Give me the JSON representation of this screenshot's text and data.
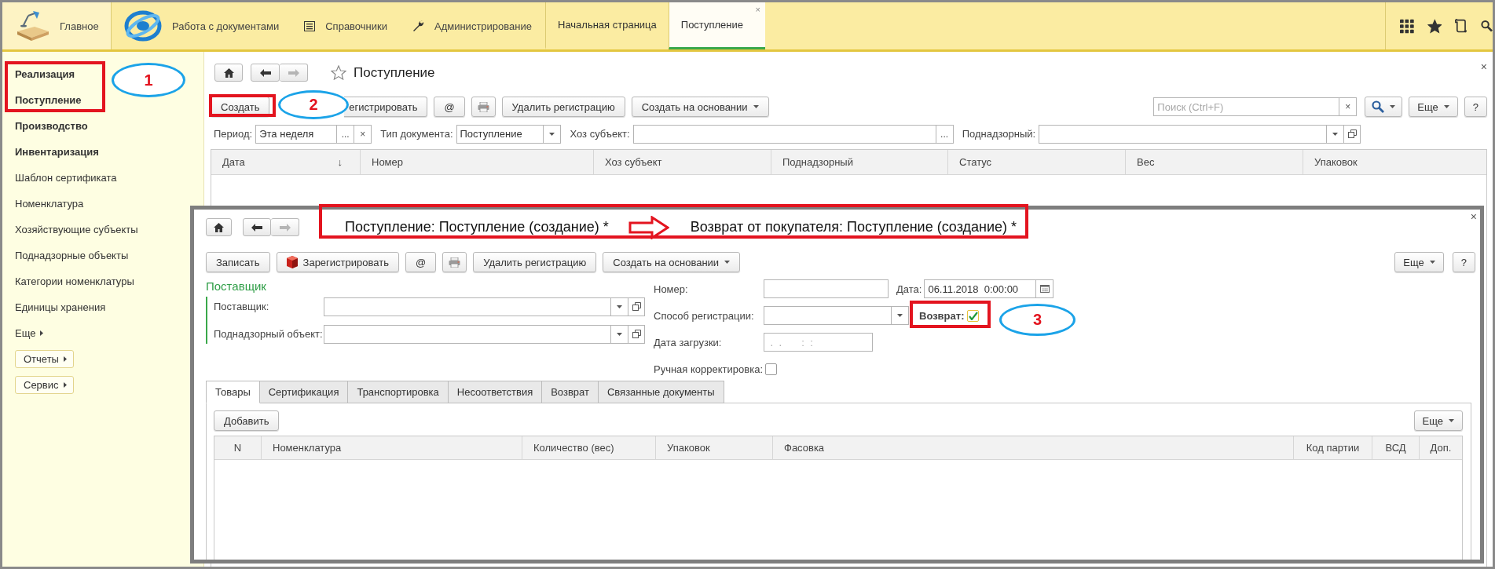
{
  "top_bar": {
    "home": {
      "label": "Главное"
    },
    "sections": [
      {
        "label": "Работа с документами",
        "kind": "logo"
      },
      {
        "label": "Справочники",
        "kind": "list"
      },
      {
        "label": "Администрирование",
        "kind": "wrench"
      }
    ],
    "open_tabs": [
      {
        "label": "Начальная страница",
        "selected": false
      },
      {
        "label": "Поступление",
        "selected": true,
        "close": "×"
      }
    ]
  },
  "sidebar": {
    "items": [
      {
        "label": "Реализация",
        "bold": true
      },
      {
        "label": "Поступление",
        "bold": true
      },
      {
        "label": "Производство",
        "bold": true
      },
      {
        "label": "Инвентаризация",
        "bold": true
      },
      {
        "label": "Шаблон сертификата",
        "bold": false
      },
      {
        "label": "Номенклатура",
        "bold": false
      },
      {
        "label": "Хозяйствующие субъекты",
        "bold": false
      },
      {
        "label": "Поднадзорные объекты",
        "bold": false
      },
      {
        "label": "Категории номенклатуры",
        "bold": false
      },
      {
        "label": "Единицы хранения",
        "bold": false
      }
    ],
    "more": "Еще",
    "buttons": [
      {
        "label": "Отчеты"
      },
      {
        "label": "Сервис"
      }
    ]
  },
  "list_form": {
    "title": "Поступление",
    "close": "×",
    "toolbar": [
      {
        "label": "Создать",
        "kind": "button"
      },
      {
        "label": "егистрировать",
        "kind": "covered"
      },
      {
        "label": "@",
        "kind": "button"
      },
      {
        "kind": "print"
      },
      {
        "label": "Удалить регистрацию",
        "kind": "button"
      },
      {
        "label": "Создать на основании",
        "kind": "menu"
      }
    ],
    "search": {
      "placeholder": "Поиск (Ctrl+F)",
      "clear": "×"
    },
    "more": "Еще",
    "help": "?",
    "filters": [
      {
        "label": "Период:",
        "value": "Эта неделя",
        "buttons": [
          "...",
          "×"
        ],
        "dropdown": false,
        "open_button": false
      },
      {
        "label": "Тип документа:",
        "value": "Поступление",
        "dropdown": true,
        "open_button": false
      },
      {
        "label": "Хоз субъект:",
        "buttons": [
          "..."
        ],
        "dropdown": false,
        "open_button": false
      },
      {
        "label": "Поднадзорный:",
        "dropdown": true,
        "open_button": true
      }
    ],
    "columns": [
      {
        "label": "Дата",
        "sort": "↓"
      },
      {
        "label": "Номер"
      },
      {
        "label": "Хоз субъект"
      },
      {
        "label": "Поднадзорный"
      },
      {
        "label": "Статус"
      },
      {
        "label": "Вес"
      },
      {
        "label": "Упаковок"
      }
    ]
  },
  "document_form": {
    "title": "Поступление: Поступление (создание) *",
    "new_title": "Возврат от покупателя: Поступление (создание) *",
    "close": "×",
    "toolbar": [
      {
        "label": "Записать",
        "kind": "button"
      },
      {
        "label": "Зарегистрировать",
        "kind": "register"
      },
      {
        "label": "@",
        "kind": "button"
      },
      {
        "kind": "print"
      },
      {
        "label": "Удалить регистрацию",
        "kind": "button"
      },
      {
        "label": "Создать на основании",
        "kind": "menu"
      }
    ],
    "more": "Еще",
    "help": "?",
    "group": {
      "title": "Поставщик",
      "fields": [
        {
          "label": "Поставщик:"
        },
        {
          "label": "Поднадзорный объект:"
        }
      ]
    },
    "number": {
      "label": "Номер:"
    },
    "date": {
      "label": "Дата:",
      "value": "06.11.2018  0:00:00"
    },
    "registration": {
      "label": "Способ регистрации:"
    },
    "return": {
      "label": "Возврат:",
      "checked": true
    },
    "load_date": {
      "label": "Дата загрузки:",
      "placeholder": " .  .       :  :"
    },
    "manual": {
      "label": "Ручная корректировка:",
      "checked": false
    },
    "tabs": [
      {
        "label": "Товары",
        "selected": true
      },
      {
        "label": "Сертификация",
        "selected": false
      },
      {
        "label": "Транспортировка",
        "selected": false
      },
      {
        "label": "Несоответствия",
        "selected": false
      },
      {
        "label": "Возврат",
        "selected": false
      },
      {
        "label": "Связанные документы",
        "selected": false
      }
    ],
    "add": "Добавить",
    "table_more": "Еще",
    "columns": [
      {
        "label": "N"
      },
      {
        "label": "Номенклатура"
      },
      {
        "label": "Количество (вес)"
      },
      {
        "label": "Упаковок"
      },
      {
        "label": "Фасовка"
      },
      {
        "label": "Код партии"
      },
      {
        "label": "ВСД"
      },
      {
        "label": "Доп."
      }
    ]
  },
  "annotations": {
    "markers": [
      {
        "label": "1"
      },
      {
        "label": "2"
      },
      {
        "label": "3"
      }
    ]
  }
}
